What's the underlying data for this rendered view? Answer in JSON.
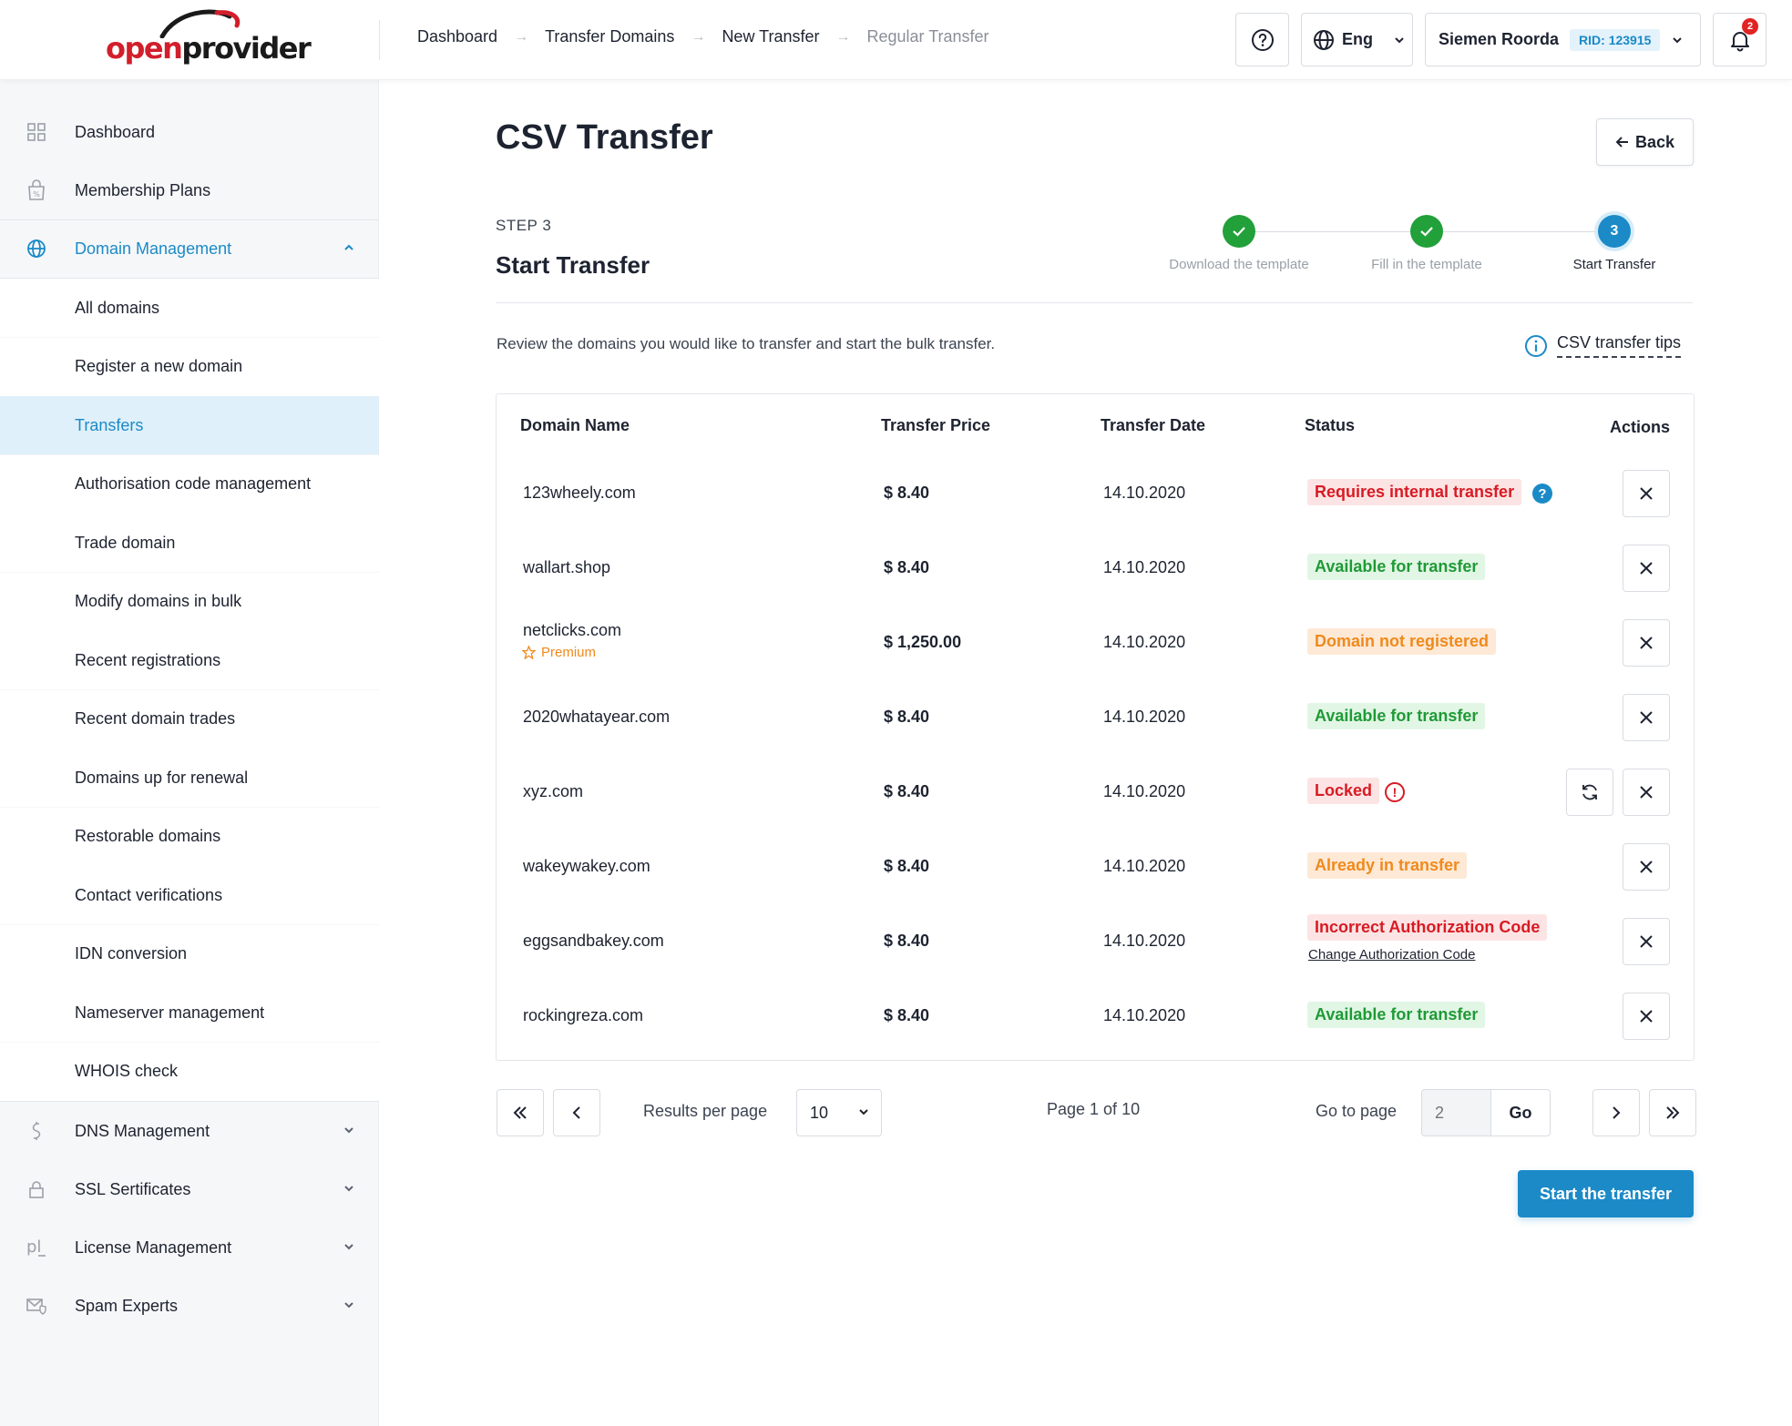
{
  "logo": {
    "text_a": "open",
    "text_b": "provider"
  },
  "breadcrumb": [
    "Dashboard",
    "Transfer Domains",
    "New Transfer",
    "Regular Transfer"
  ],
  "header": {
    "lang": "Eng",
    "user_name": "Siemen Roorda",
    "rid": "RID: 123915",
    "notifications": "2"
  },
  "sidebar": {
    "top_items": [
      {
        "label": "Dashboard",
        "icon": "grid-icon"
      },
      {
        "label": "Membership Plans",
        "icon": "bag-percent-icon"
      }
    ],
    "domain_management": {
      "label": "Domain Management",
      "icon": "globe-icon"
    },
    "sub_items": [
      "All domains",
      "Register a new domain",
      "Transfers",
      "Authorisation code management",
      "Trade domain",
      "Modify domains in bulk",
      "Recent registrations",
      "Recent domain trades",
      "Domains up for renewal",
      "Restorable domains",
      "Contact verifications",
      "IDN conversion",
      "Nameserver management",
      "WHOIS check"
    ],
    "selected_sub": "Transfers",
    "bottom_items": [
      {
        "label": "DNS Management",
        "icon": "dns-icon"
      },
      {
        "label": "SSL Sertificates",
        "icon": "lock-icon"
      },
      {
        "label": "License Management",
        "icon": "license-icon"
      },
      {
        "label": "Spam Experts",
        "icon": "mail-shield-icon"
      }
    ]
  },
  "page": {
    "title": "CSV Transfer",
    "back_label": "Back",
    "step_label": "STEP 3",
    "step_title": "Start Transfer",
    "steps": [
      {
        "label": "Download the template",
        "state": "done"
      },
      {
        "label": "Fill in the template",
        "state": "done"
      },
      {
        "label": "Start Transfer",
        "state": "current",
        "number": "3"
      }
    ],
    "description": "Review the domains you would like to transfer and start the bulk transfer.",
    "tips_label": "CSV transfer tips"
  },
  "table": {
    "columns": [
      "Domain Name",
      "Transfer Price",
      "Transfer Date",
      "Status",
      "Actions"
    ],
    "rows": [
      {
        "domain": "123wheely.com",
        "price": "$ 8.40",
        "date": "14.10.2020",
        "status": "Requires internal transfer",
        "status_color": "red",
        "extra_icon": "question-icon"
      },
      {
        "domain": "wallart.shop",
        "price": "$ 8.40",
        "date": "14.10.2020",
        "status": "Available for transfer",
        "status_color": "green"
      },
      {
        "domain": "netclicks.com",
        "tag": "Premium",
        "price": "$ 1,250.00",
        "date": "14.10.2020",
        "status": "Domain not registered",
        "status_color": "orange"
      },
      {
        "domain": "2020whatayear.com",
        "price": "$ 8.40",
        "date": "14.10.2020",
        "status": "Available for transfer",
        "status_color": "green"
      },
      {
        "domain": "xyz.com",
        "price": "$ 8.40",
        "date": "14.10.2020",
        "status": "Locked",
        "status_color": "red",
        "extra_icon": "info-icon",
        "refresh": true
      },
      {
        "domain": "wakeywakey.com",
        "price": "$ 8.40",
        "date": "14.10.2020",
        "status": "Already in transfer",
        "status_color": "orange"
      },
      {
        "domain": "eggsandbakey.com",
        "price": "$ 8.40",
        "date": "14.10.2020",
        "status": "Incorrect Authorization Code",
        "status_color": "red",
        "link": "Change Authorization Code"
      },
      {
        "domain": "rockingreza.com",
        "price": "$ 8.40",
        "date": "14.10.2020",
        "status": "Available for transfer",
        "status_color": "green"
      }
    ]
  },
  "pagination": {
    "results_per_page_label": "Results per page",
    "per_page_value": "10",
    "page_info": "Page 1 of 10",
    "go_to_label": "Go to page",
    "go_to_placeholder": "2",
    "go_label": "Go"
  },
  "start_button": "Start the transfer",
  "colors": {
    "accent": "#1b8ac7",
    "success": "#22a03a",
    "danger": "#d81b24",
    "warning": "#f08a1c"
  }
}
